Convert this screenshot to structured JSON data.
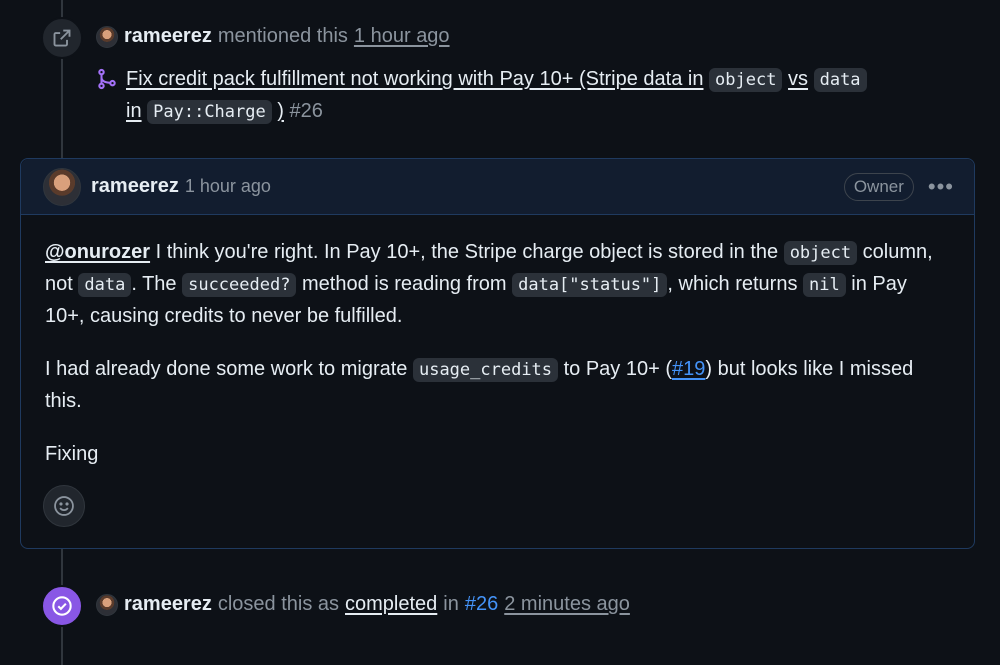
{
  "ref_event": {
    "actor": "rameerez",
    "action": "mentioned this",
    "time": "1 hour ago",
    "pr_title_part1": "Fix credit pack fulfillment not working with Pay 10+ (Stripe data in",
    "pr_code1": "object",
    "pr_vs": "vs",
    "pr_code2": "data",
    "pr_in": "in",
    "pr_code3": "Pay::Charge",
    "pr_close": ")",
    "pr_number": "#26"
  },
  "comment": {
    "author": "rameerez",
    "time": "1 hour ago",
    "role_badge": "Owner",
    "menu_label": "•••",
    "p1": {
      "mention": "@onurozer",
      "t1": " I think you're right. In Pay 10+, the Stripe charge object is stored in the ",
      "c1": "object",
      "t2": " column, not ",
      "c2": "data",
      "t3": ". The ",
      "c3": "succeeded?",
      "t4": " method is reading from ",
      "c4": "data[\"status\"]",
      "t5": ", which returns ",
      "c5": "nil",
      "t6": " in Pay 10+, causing credits to never be fulfilled."
    },
    "p2": {
      "t1": "I had already done some work to migrate ",
      "c1": "usage_credits",
      "t2": " to Pay 10+ (",
      "link": "#19",
      "t3": ") but looks like I missed this."
    },
    "p3": "Fixing"
  },
  "close_event": {
    "actor": "rameerez",
    "action": "closed this as",
    "state": "completed",
    "in": "in",
    "pr": "#26",
    "time": "2 minutes ago"
  },
  "colors": {
    "background": "#0d1117",
    "accent_purple": "#8957e5",
    "link_blue": "#4493f8",
    "muted": "#8b949e"
  },
  "icons": [
    "external-link-icon",
    "pull-request-icon",
    "kebab-menu-icon",
    "smiley-icon",
    "check-circle-icon"
  ]
}
